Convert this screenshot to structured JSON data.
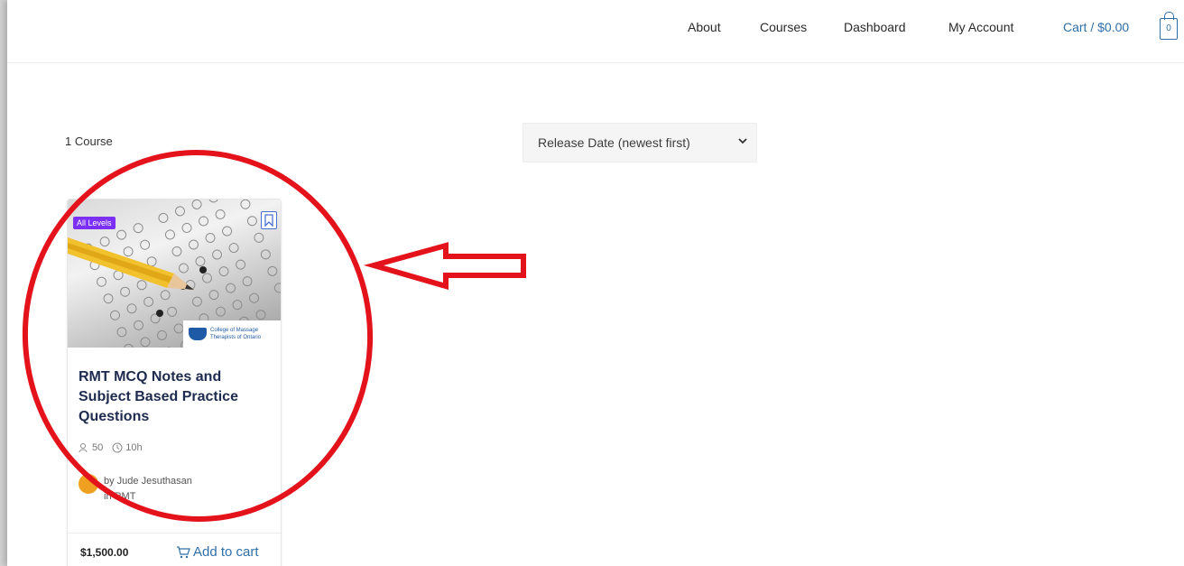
{
  "nav": {
    "about": "About",
    "courses": "Courses",
    "dashboard": "Dashboard",
    "my_account": "My Account",
    "cart": "Cart / $0.00",
    "cart_count": "0"
  },
  "toolbar": {
    "count": "1 Course",
    "sort_value": "Release Date (newest first)"
  },
  "course": {
    "level_badge": "All Levels",
    "thumb_logo_line1": "College of Massage",
    "thumb_logo_line2": "Therapists of Ontario",
    "title": "RMT MCQ Notes and Subject Based Practice Questions",
    "students": "50",
    "duration": "10h",
    "author": "by Jude Jesuthasan",
    "category": "in RMT",
    "price": "$1,500.00",
    "add_to_cart": "Add to cart"
  },
  "colors": {
    "accent": "#2f6fa8",
    "badge": "#7b2ff7",
    "annotation": "#e3121b"
  },
  "icons": [
    "cart-bag-icon",
    "chevron-down-icon",
    "bookmark-icon",
    "students-icon",
    "clock-icon",
    "cart-icon"
  ]
}
